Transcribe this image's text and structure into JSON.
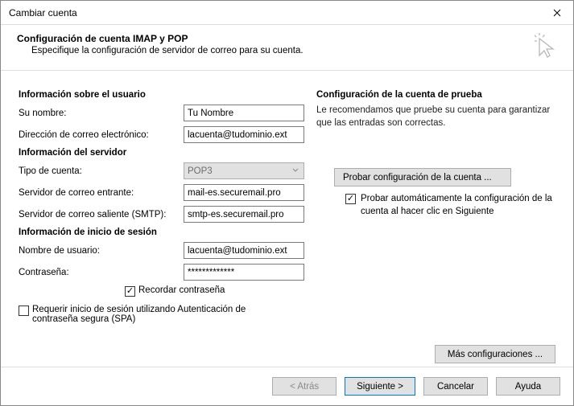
{
  "window": {
    "title": "Cambiar cuenta"
  },
  "header": {
    "title": "Configuración de cuenta IMAP y POP",
    "subtitle": "Especifique la configuración de servidor de correo para su cuenta."
  },
  "left": {
    "user_info_head": "Información sobre el usuario",
    "name_label": "Su nombre:",
    "name_value": "Tu Nombre",
    "email_label": "Dirección de correo electrónico:",
    "email_value": "lacuenta@tudominio.ext",
    "server_info_head": "Información del servidor",
    "account_type_label": "Tipo de cuenta:",
    "account_type_value": "POP3",
    "incoming_label": "Servidor de correo entrante:",
    "incoming_value": "mail-es.securemail.pro",
    "outgoing_label": "Servidor de correo saliente (SMTP):",
    "outgoing_value": "smtp-es.securemail.pro",
    "login_info_head": "Información de inicio de sesión",
    "username_label": "Nombre de usuario:",
    "username_value": "lacuenta@tudominio.ext",
    "password_label": "Contraseña:",
    "password_value": "*************",
    "remember_label": "Recordar contraseña",
    "spa_label": "Requerir inicio de sesión utilizando Autenticación de contraseña segura (SPA)"
  },
  "right": {
    "test_head": "Configuración de la cuenta de prueba",
    "test_desc": "Le recomendamos que pruebe su cuenta para garantizar que las entradas son correctas.",
    "test_button": "Probar configuración de la cuenta ...",
    "auto_test_label": "Probar automáticamente la configuración de la cuenta al hacer clic en Siguiente",
    "more_button": "Más configuraciones ..."
  },
  "footer": {
    "back": "< Atrás",
    "next": "Siguiente >",
    "cancel": "Cancelar",
    "help": "Ayuda"
  }
}
